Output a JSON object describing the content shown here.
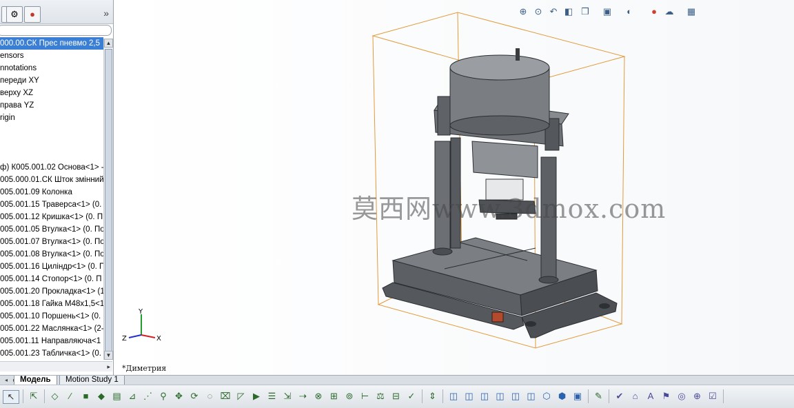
{
  "feature_tree": {
    "tabs": [
      {
        "name": "property-manager-tab",
        "glyph": "▤"
      },
      {
        "name": "configuration-manager-tab",
        "glyph": "⚙"
      },
      {
        "name": "display-manager-tab",
        "glyph": "●"
      }
    ],
    "items_top": [
      {
        "label": "000.00.СК Прес пневмо 2,5",
        "selected": true
      },
      {
        "label": "ensors"
      },
      {
        "label": "nnotations"
      },
      {
        "label": "переди XY"
      },
      {
        "label": "верху XZ"
      },
      {
        "label": "права YZ"
      },
      {
        "label": "rigin"
      }
    ],
    "items_components": [
      {
        "label": "ф) К005.001.02 Основа<1> -"
      },
      {
        "label": "005.000.01.СК Шток змінний"
      },
      {
        "label": "005.001.09 Колонка"
      },
      {
        "label": "005.001.15 Траверса<1> (0."
      },
      {
        "label": "005.001.12 Кришка<1> (0. П"
      },
      {
        "label": "005.001.05 Втулка<1> (0. По"
      },
      {
        "label": "005.001.07 Втулка<1> (0. По"
      },
      {
        "label": "005.001.08 Втулка<1> (0. По"
      },
      {
        "label": "005.001.16 Циліндр<1> (0. П"
      },
      {
        "label": "005.001.14 Стопор<1> (0. П"
      },
      {
        "label": "005.001.20 Прокладка<1> (1"
      },
      {
        "label": "005.001.18 Гайка М48х1,5<1"
      },
      {
        "label": "005.001.10 Поршень<1> (0."
      },
      {
        "label": "005.001.22 Маслянка<1> (2-"
      },
      {
        "label": "005.001.11 Направляюча<1"
      },
      {
        "label": "005.001.23 Табличка<1> (0."
      }
    ]
  },
  "viewport": {
    "view_name": "*Диметрия",
    "watermark": "莫西网www.3dmox.com",
    "triad": {
      "x": "X",
      "y": "Y",
      "z": "Z"
    },
    "heads_up_icons": [
      "zoom-to-fit-icon",
      "zoom-to-area-icon",
      "previous-view-icon",
      "section-view-icon",
      "view-orientation-icon",
      "display-style-icon",
      "hide-show-items-icon",
      "edit-appearance-icon",
      "apply-scene-icon",
      "view-settings-icon"
    ]
  },
  "bottom_tabs": [
    {
      "label": "Модель",
      "active": true
    },
    {
      "label": "Motion Study 1",
      "active": false
    }
  ],
  "toolbar": {
    "groups": [
      [
        "select-icon"
      ],
      [
        "select-other-icon"
      ],
      [
        "smart-dimension-icon",
        "sketch-icon",
        "extruded-boss-icon",
        "revolved-boss-icon",
        "insert-component-icon",
        "mate-icon",
        "linear-pattern-icon",
        "smart-fasteners-icon",
        "move-component-icon",
        "rotate-component-icon",
        "show-hidden-icon",
        "assembly-features-icon",
        "reference-geometry-icon",
        "new-motion-study-icon",
        "bill-of-materials-icon",
        "exploded-view-icon",
        "explode-line-sketch-icon",
        "interference-detection-icon",
        "clearance-verification-icon",
        "hole-alignment-icon",
        "measure-icon",
        "mass-properties-icon",
        "section-properties-icon",
        "check-icon"
      ],
      [
        "view-normal-icon"
      ],
      [
        "front-view-icon",
        "back-view-icon",
        "left-view-icon",
        "right-view-icon",
        "top-view-icon",
        "bottom-view-icon",
        "isometric-view-icon",
        "trimetric-view-icon",
        "dimetric-view-icon"
      ],
      [
        "edit-component-icon"
      ],
      [
        "spell-check-icon",
        "format-painter-icon",
        "note-icon",
        "balloon-icon",
        "surface-finish-icon",
        "weld-symbol-icon",
        "design-checker-icon"
      ]
    ]
  }
}
